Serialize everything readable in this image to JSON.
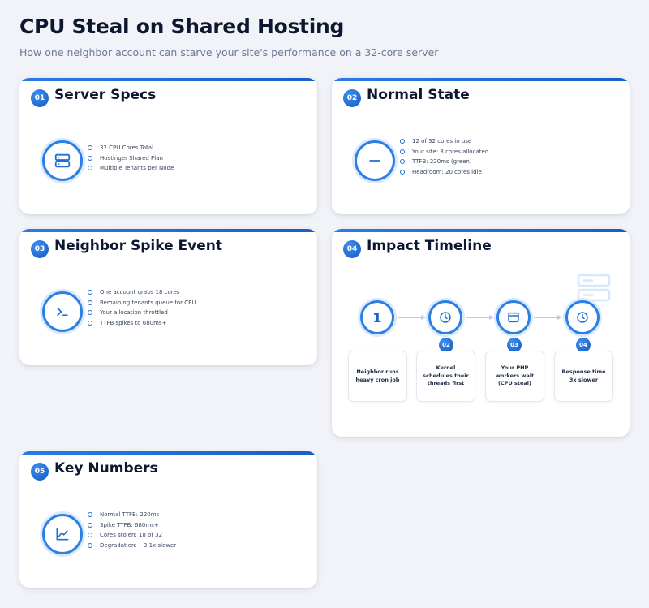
{
  "header": {
    "title": "CPU Steal on Shared Hosting",
    "subtitle": "How one neighbor account can starve your site's performance on a 32-core server"
  },
  "cards": [
    {
      "num": "01",
      "title": "Server Specs",
      "icon": "server-icon",
      "bullets": [
        "32 CPU Cores Total",
        "Hostinger Shared Plan",
        "Multiple Tenants per Node"
      ]
    },
    {
      "num": "02",
      "title": "Normal State",
      "icon": "minus-icon",
      "bullets": [
        "12 of 32 cores in use",
        "Your site: 3 cores allocated",
        "TTFB: 220ms (green)",
        "Headroom: 20 cores idle"
      ]
    },
    {
      "num": "03",
      "title": "Neighbor Spike Event",
      "icon": "terminal-icon",
      "bullets": [
        "One account grabs 18 cores",
        "Remaining tenants queue for CPU",
        "Your allocation throttled",
        "TTFB spikes to 680ms+"
      ]
    },
    {
      "num": "04",
      "title": "Impact Timeline",
      "steps": [
        {
          "marker": "1",
          "icon": "",
          "badge": "",
          "label": "Neighbor runs heavy cron job"
        },
        {
          "marker": "",
          "icon": "clock-icon",
          "badge": "02",
          "label": "Kernel schedules their threads first"
        },
        {
          "marker": "",
          "icon": "browser-window-icon",
          "badge": "03",
          "label": "Your PHP workers wait (CPU steal)"
        },
        {
          "marker": "",
          "icon": "clock-icon",
          "badge": "04",
          "label": "Response time 3x slower"
        }
      ]
    },
    {
      "num": "05",
      "title": "Key Numbers",
      "icon": "line-chart-icon",
      "bullets": [
        "Normal TTFB: 220ms",
        "Spike TTFB: 680ms+",
        "Cores stolen: 18 of 32",
        "Degradation: ~3.1x slower"
      ]
    }
  ],
  "colors": {
    "accent": "#2b7fe5",
    "accent_dark": "#1559c0",
    "background": "#f1f3f8",
    "title": "#0d1730"
  }
}
